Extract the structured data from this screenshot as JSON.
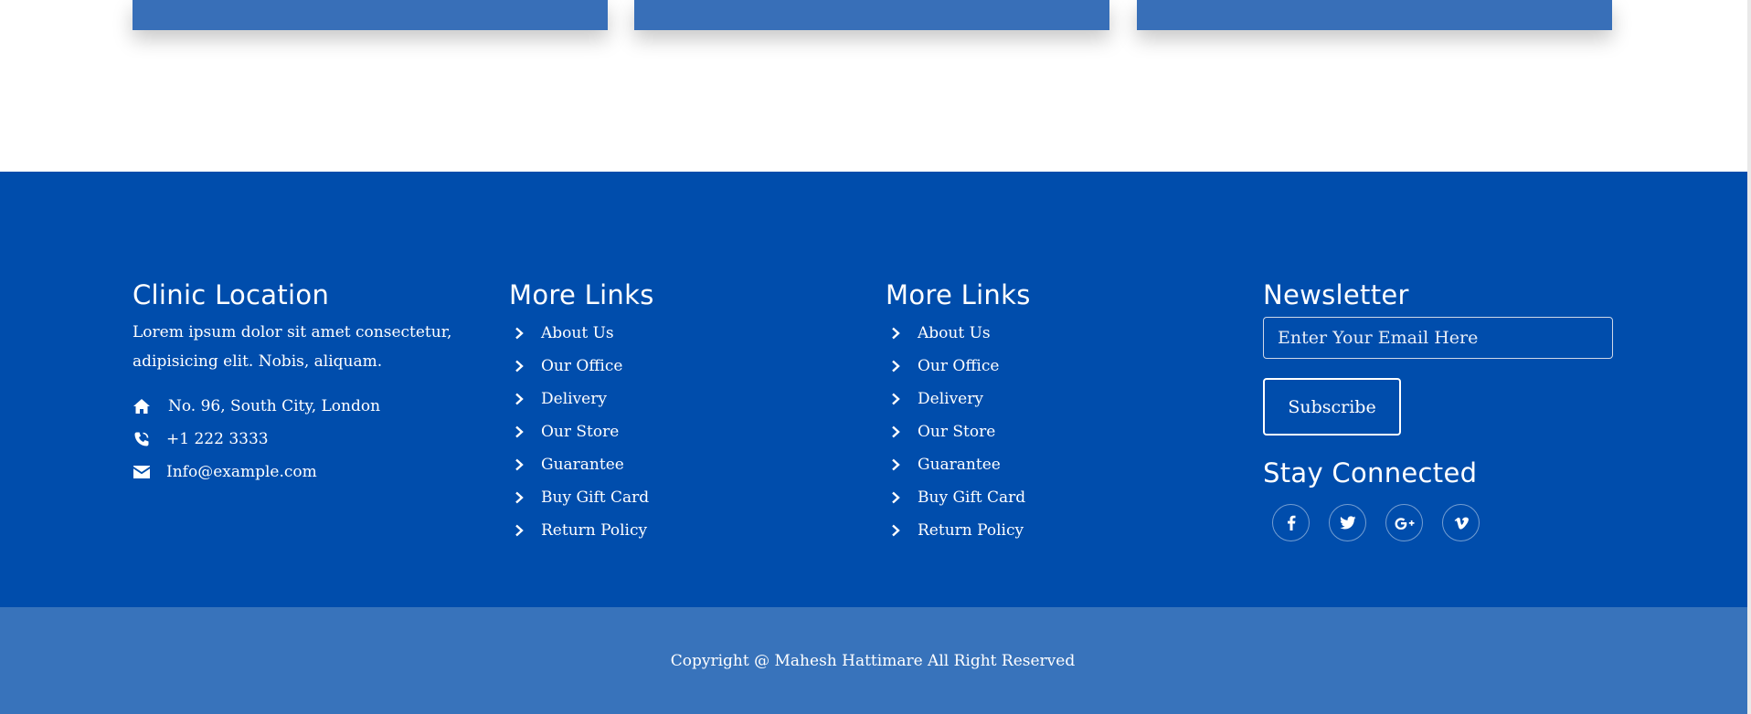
{
  "clinic": {
    "title": "Clinic Location",
    "description": "Lorem ipsum dolor sit amet consectetur, adipisicing elit. Nobis, aliquam.",
    "address": "No. 96, South City, London",
    "phone": "+1 222 3333",
    "email": "Info@example.com"
  },
  "links_col1": {
    "title": "More Links",
    "items": [
      "About Us",
      "Our Office",
      "Delivery",
      "Our Store",
      "Guarantee",
      "Buy Gift Card",
      "Return Policy"
    ]
  },
  "links_col2": {
    "title": "More Links",
    "items": [
      "About Us",
      "Our Office",
      "Delivery",
      "Our Store",
      "Guarantee",
      "Buy Gift Card",
      "Return Policy"
    ]
  },
  "newsletter": {
    "title": "Newsletter",
    "email_placeholder": "Enter Your Email Here",
    "email_value": "",
    "subscribe_label": "Subscribe"
  },
  "social": {
    "title": "Stay Connected",
    "icons": [
      "facebook-icon",
      "twitter-icon",
      "google-plus-icon",
      "vimeo-icon"
    ]
  },
  "footer": {
    "copyright": "Copyright @ Mahesh Hattimare All Right Reserved"
  },
  "colors": {
    "footer_bg": "#004dac",
    "copyright_bg": "#3873bb",
    "card_bg": "#386fb8",
    "text": "#ffffff"
  }
}
